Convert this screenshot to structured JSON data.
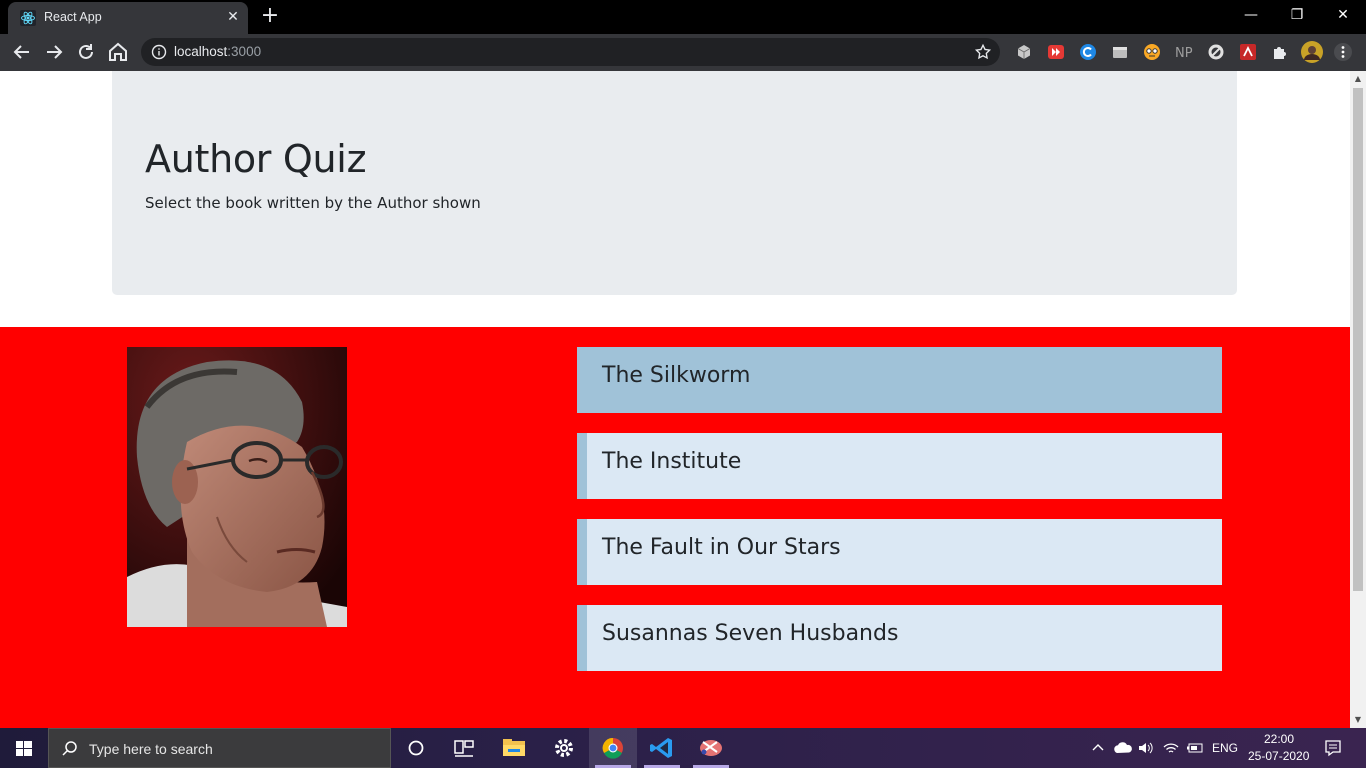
{
  "browser": {
    "tab_title": "React App",
    "url_host": "localhost",
    "url_port": ":3000"
  },
  "page": {
    "title": "Author Quiz",
    "subtitle": "Select the book written by the Author shown",
    "answers": [
      {
        "label": "The Silkworm",
        "selected": true
      },
      {
        "label": "The Institute",
        "selected": false
      },
      {
        "label": "The Fault in Our Stars",
        "selected": false
      },
      {
        "label": "Susannas Seven Husbands",
        "selected": false
      }
    ],
    "colors": {
      "jumbotron_bg": "#e9ecef",
      "quiz_bg": "#ff0000",
      "answer_bg": "#dbe8f4",
      "answer_selected_bg": "#a0c2d8"
    }
  },
  "taskbar": {
    "search_placeholder": "Type here to search",
    "language": "ENG",
    "time": "22:00",
    "date": "25-07-2020"
  }
}
